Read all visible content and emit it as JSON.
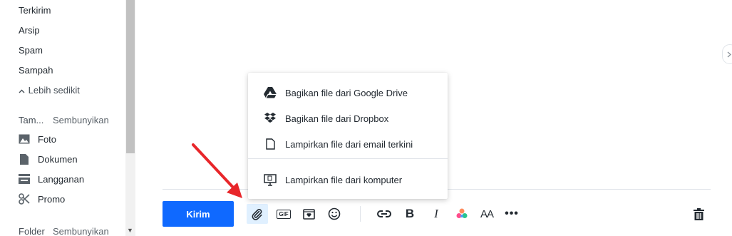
{
  "sidebar": {
    "folders": [
      {
        "label": "Terkirim"
      },
      {
        "label": "Arsip"
      },
      {
        "label": "Spam"
      },
      {
        "label": "Sampah"
      }
    ],
    "less_toggle": "Lebih sedikit",
    "views_section": {
      "label": "Tam...",
      "hide": "Sembunyikan"
    },
    "views": [
      {
        "label": "Foto",
        "icon": "photo-icon"
      },
      {
        "label": "Dokumen",
        "icon": "document-icon"
      },
      {
        "label": "Langganan",
        "icon": "subscriptions-icon"
      },
      {
        "label": "Promo",
        "icon": "scissors-icon"
      }
    ],
    "folder_section": {
      "label": "Folder",
      "hide": "Sembunyikan"
    }
  },
  "compose": {
    "send_label": "Kirim",
    "toolbar": [
      {
        "name": "attach-button",
        "icon": "paperclip-icon"
      },
      {
        "name": "gif-button",
        "icon": "gif-icon",
        "text": "GIF"
      },
      {
        "name": "sticker-button",
        "icon": "sticker-icon"
      },
      {
        "name": "emoji-button",
        "icon": "smiley-icon"
      },
      {
        "name": "link-button",
        "icon": "link-icon"
      },
      {
        "name": "bold-button",
        "icon": "bold-icon",
        "text": "B"
      },
      {
        "name": "italic-button",
        "icon": "italic-icon",
        "text": "I"
      },
      {
        "name": "color-button",
        "icon": "color-palette-icon"
      },
      {
        "name": "font-size-button",
        "icon": "font-size-icon",
        "text": "AA"
      },
      {
        "name": "more-button",
        "icon": "more-icon",
        "text": "•••"
      },
      {
        "name": "delete-button",
        "icon": "trash-icon"
      }
    ]
  },
  "attach_menu": {
    "items": [
      {
        "label": "Bagikan file dari Google Drive",
        "icon": "google-drive-icon"
      },
      {
        "label": "Bagikan file dari Dropbox",
        "icon": "dropbox-icon"
      },
      {
        "label": "Lampirkan file dari email terkini",
        "icon": "file-icon"
      },
      {
        "label": "Lampirkan file dari komputer",
        "icon": "computer-icon"
      }
    ]
  },
  "colors": {
    "send_button": "#0f69ff",
    "active_tool_bg": "#e0f0ff",
    "annotation_arrow": "#e8262a"
  }
}
